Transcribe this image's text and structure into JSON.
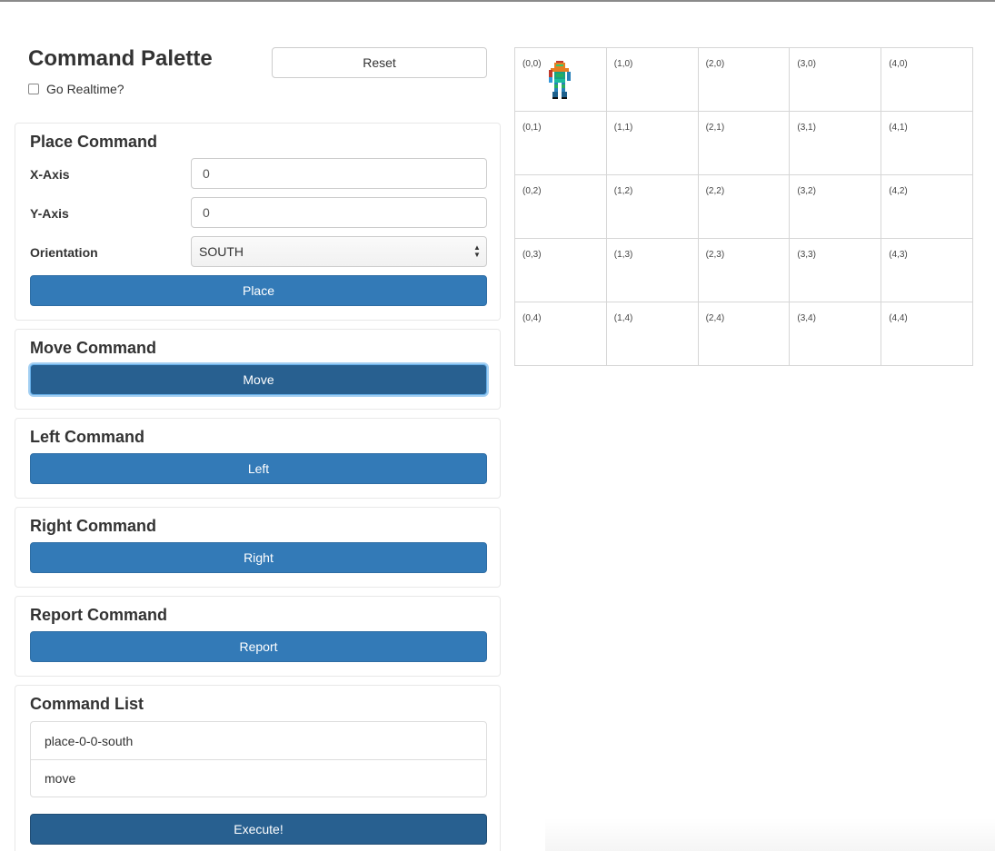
{
  "header": {
    "title": "Command Palette",
    "realtime_label": "Go Realtime?",
    "reset_label": "Reset"
  },
  "place": {
    "title": "Place Command",
    "x_label": "X-Axis",
    "x_value": "0",
    "y_label": "Y-Axis",
    "y_value": "0",
    "orientation_label": "Orientation",
    "orientation_value": "SOUTH",
    "button_label": "Place"
  },
  "move": {
    "title": "Move Command",
    "button_label": "Move"
  },
  "left": {
    "title": "Left Command",
    "button_label": "Left"
  },
  "right": {
    "title": "Right Command",
    "button_label": "Right"
  },
  "report": {
    "title": "Report Command",
    "button_label": "Report"
  },
  "command_list": {
    "title": "Command List",
    "items": [
      "place-0-0-south",
      "move"
    ],
    "execute_label": "Execute!"
  },
  "grid": {
    "rows": [
      [
        "(0,0)",
        "(1,0)",
        "(2,0)",
        "(3,0)",
        "(4,0)"
      ],
      [
        "(0,1)",
        "(1,1)",
        "(2,1)",
        "(3,1)",
        "(4,1)"
      ],
      [
        "(0,2)",
        "(1,2)",
        "(2,2)",
        "(3,2)",
        "(4,2)"
      ],
      [
        "(0,3)",
        "(1,3)",
        "(2,3)",
        "(3,3)",
        "(4,3)"
      ],
      [
        "(0,4)",
        "(1,4)",
        "(2,4)",
        "(3,4)",
        "(4,4)"
      ]
    ],
    "robot_cell": "(0,0)"
  },
  "colors": {
    "primary": "#337ab7",
    "primary_active": "#286090",
    "border": "#cccccc"
  }
}
